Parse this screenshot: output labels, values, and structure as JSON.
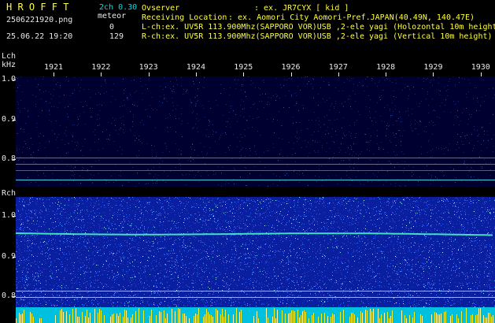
{
  "header": {
    "app_title": "H R O F F T",
    "version": "2ch 0.30",
    "filename": "2506221920.png",
    "datetime": "25.06.22 19:20",
    "meteor_label": "meteor",
    "lch_count": "0",
    "rch_count": "129",
    "observer_label": "Ovserver",
    "observer_value": ": ex. JR7CYX [ kid ]",
    "location_label": "Receiving Location",
    "location_value": ": ex. Aomori City Aomori-Pref.JAPAN(40.49N, 140.47E)",
    "lch_info": "L-ch:ex. UV5R 113.900Mhz(SAPPORO VOR)USB ,2-ele yagi (Holozontal 10m height",
    "rch_info": "R-ch:ex. UV5R 113.900Mhz(SAPPORO VOR)USB ,2-ele yagi (Vertical 10m height)"
  },
  "axis": {
    "lch_label": "Lch",
    "khz_label": "kHz",
    "rch_label": "Rch",
    "time_ticks": [
      "1921",
      "1922",
      "1923",
      "1924",
      "1925",
      "1926",
      "1927",
      "1928",
      "1929",
      "1930"
    ],
    "lch_freq_ticks": [
      "1.0",
      "0.9",
      "0.8"
    ],
    "rch_freq_ticks": [
      "1.0",
      "0.9",
      "0.8"
    ]
  },
  "colors": {
    "text_cyan": "#00e0e0",
    "text_white": "#e8e8e8",
    "text_yellow": "#ffff40",
    "lch_background": "#000030",
    "rch_background": "#0a1ea0",
    "signal_trace": "#40e0c0"
  }
}
